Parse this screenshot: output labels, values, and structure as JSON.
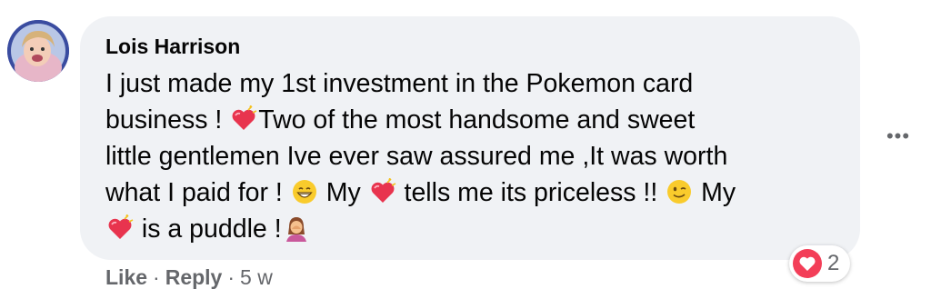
{
  "comment": {
    "author": "Lois Harrison",
    "lines": [
      [
        "I just made my 1st investment in the Pokemon card"
      ],
      [
        "business ! ",
        {
          "emoji": "heart-exclamation"
        },
        "Two of the most handsome and sweet"
      ],
      [
        "little gentlemen Ive ever saw assured me ,It was worth"
      ],
      [
        "what I paid for ! ",
        {
          "emoji": "grinning-face"
        },
        " My ",
        {
          "emoji": "heart-exclamation"
        },
        " tells me its priceless !! ",
        {
          "emoji": "winking-face"
        },
        " My"
      ],
      [
        {
          "emoji": "heart-exclamation"
        },
        " is a puddle !",
        {
          "emoji": "woman-facepalming"
        }
      ]
    ]
  },
  "actions": {
    "like_label": "Like",
    "reply_label": "Reply",
    "separator": "·",
    "timestamp": "5 w"
  },
  "reactions": {
    "icon": "love-reaction-icon",
    "count": "2",
    "color": "#f33e58"
  },
  "more_options_label": "•••",
  "colors": {
    "bubble_bg": "#f0f2f5",
    "text": "#050505",
    "secondary_text": "#65676b"
  }
}
